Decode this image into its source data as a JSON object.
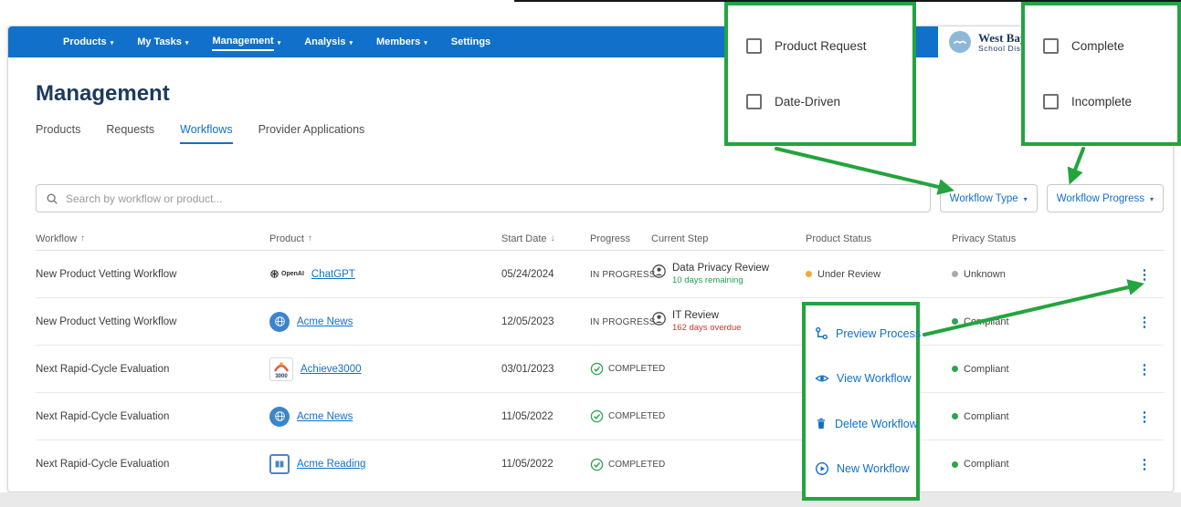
{
  "colors": {
    "navbar_blue": "#1170C9",
    "accent_blue": "#1170C9",
    "callout_green": "#23A43F",
    "status_under_review": "#F0A93B",
    "status_unknown": "#ABABAB",
    "status_compliant": "#2EA44F",
    "note_remaining_green": "#1E9E4A",
    "note_overdue_red": "#D0342C"
  },
  "navbar": {
    "caret": "▾",
    "items": [
      {
        "label": "Products"
      },
      {
        "label": "My Tasks"
      },
      {
        "label": "Management"
      },
      {
        "label": "Analysis"
      },
      {
        "label": "Members"
      },
      {
        "label": "Settings"
      }
    ],
    "org": {
      "name_line1": "West Bay",
      "name_line2": "School Distr"
    }
  },
  "page": {
    "title": "Management"
  },
  "tabs": [
    {
      "label": "Products"
    },
    {
      "label": "Requests"
    },
    {
      "label": "Workflows"
    },
    {
      "label": "Provider Applications"
    }
  ],
  "search": {
    "placeholder": "Search by workflow or product..."
  },
  "filters": {
    "workflow_type": {
      "button_label": "Workflow Type",
      "caret": "▾",
      "options": [
        "Product Request",
        "Date-Driven"
      ]
    },
    "workflow_progress": {
      "button_label": "Workflow Progress",
      "caret": "▾",
      "options": [
        "Complete",
        "Incomplete"
      ]
    }
  },
  "action_menu": {
    "items": [
      {
        "icon": "process-icon",
        "label": "Preview Process"
      },
      {
        "icon": "eye-icon",
        "label": "View Workflow"
      },
      {
        "icon": "trash-icon",
        "label": "Delete Workflow"
      },
      {
        "icon": "play-icon",
        "label": "New Workflow"
      }
    ]
  },
  "table": {
    "kebab": "⋮",
    "columns": [
      {
        "label": "Workflow",
        "sort": "↑"
      },
      {
        "label": "Product",
        "sort": "↑"
      },
      {
        "label": "Start Date",
        "sort": "↓"
      },
      {
        "label": "Progress",
        "sort": ""
      },
      {
        "label": "Current Step",
        "sort": ""
      },
      {
        "label": "Product Status",
        "sort": ""
      },
      {
        "label": "Privacy Status",
        "sort": ""
      }
    ],
    "rows": [
      {
        "workflow": "New Product Vetting Workflow",
        "product": {
          "name": "ChatGPT",
          "brand": "OpenAI"
        },
        "start_date": "05/24/2024",
        "progress": "IN PROGRESS",
        "current_step": {
          "name": "Data Privacy Review",
          "note": "10 days remaining"
        },
        "product_status": "Under Review",
        "privacy_status": "Unknown"
      },
      {
        "workflow": "New Product Vetting Workflow",
        "product": {
          "name": "Acme News"
        },
        "start_date": "12/05/2023",
        "progress": "IN PROGRESS",
        "current_step": {
          "name": "IT Review",
          "note": "162 days overdue"
        },
        "product_status": "",
        "privacy_status": "Compliant"
      },
      {
        "workflow": "Next Rapid-Cycle Evaluation",
        "product": {
          "name": "Achieve3000",
          "logo_text": "3000"
        },
        "start_date": "03/01/2023",
        "progress": "COMPLETED",
        "current_step": {
          "name": "",
          "note": ""
        },
        "product_status": "",
        "privacy_status": "Compliant"
      },
      {
        "workflow": "Next Rapid-Cycle Evaluation",
        "product": {
          "name": "Acme News"
        },
        "start_date": "11/05/2022",
        "progress": "COMPLETED",
        "current_step": {
          "name": "",
          "note": ""
        },
        "product_status": "",
        "privacy_status": "Compliant"
      },
      {
        "workflow": "Next Rapid-Cycle Evaluation",
        "product": {
          "name": "Acme Reading"
        },
        "start_date": "11/05/2022",
        "progress": "COMPLETED",
        "current_step": {
          "name": "",
          "note": ""
        },
        "product_status": "",
        "privacy_status": "Compliant"
      }
    ]
  }
}
